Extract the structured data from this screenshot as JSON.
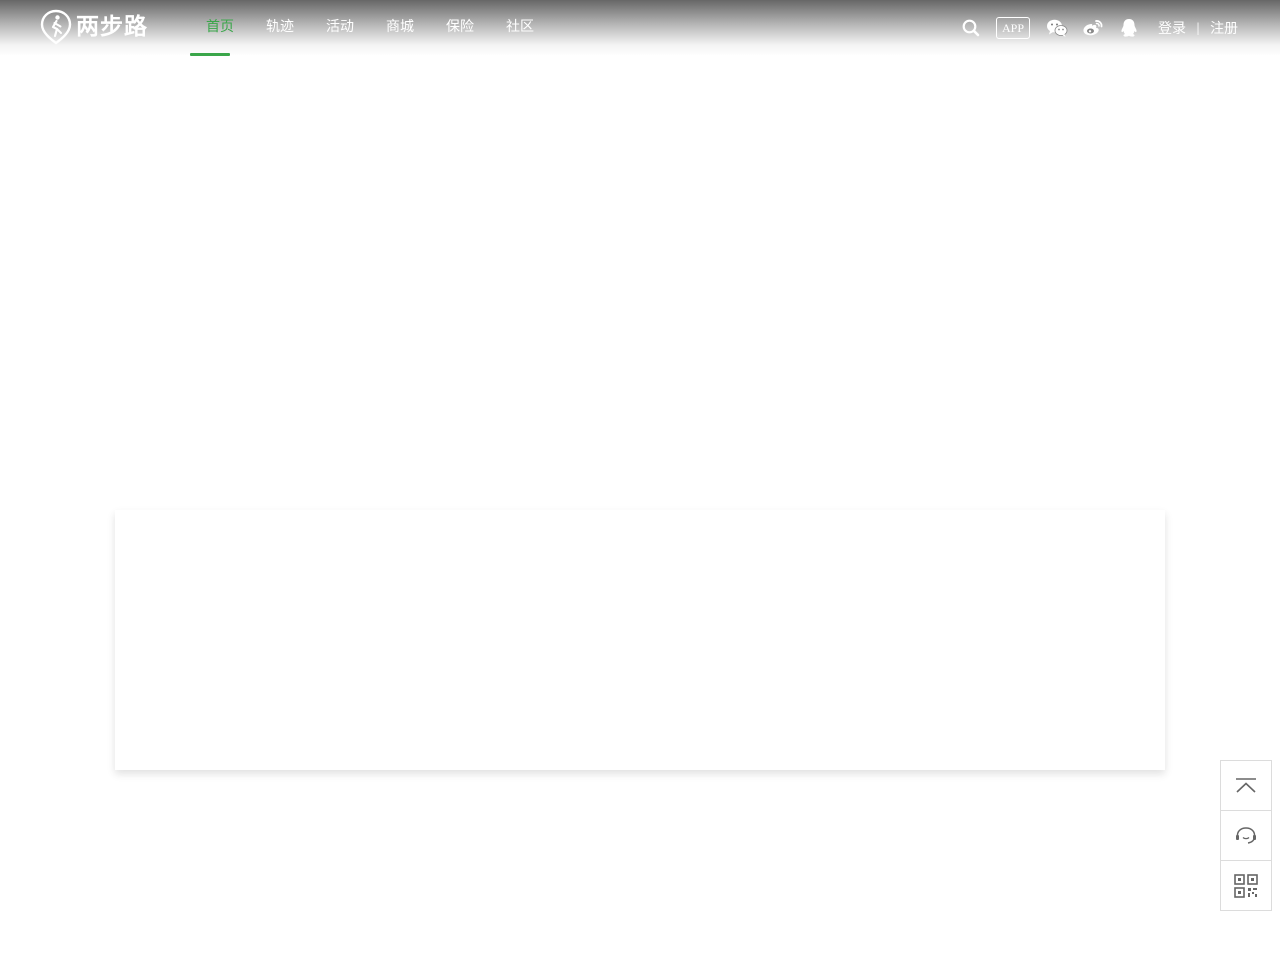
{
  "brand": {
    "logo_text": "两步路",
    "logo_icon": "walker-pin-icon"
  },
  "nav": {
    "items": [
      {
        "label": "首页",
        "active": true
      },
      {
        "label": "轨迹",
        "active": false
      },
      {
        "label": "活动",
        "active": false
      },
      {
        "label": "商城",
        "active": false
      },
      {
        "label": "保险",
        "active": false
      },
      {
        "label": "社区",
        "active": false
      }
    ],
    "active_color": "#3aa64a"
  },
  "toolbar": {
    "search_icon": "search-icon",
    "app_label": "APP",
    "wechat_icon": "wechat-icon",
    "weibo_icon": "weibo-icon",
    "qq_icon": "qq-icon"
  },
  "auth": {
    "login_label": "登录",
    "separator": "|",
    "register_label": "注册"
  },
  "float_bar": {
    "items": [
      "back-to-top-icon",
      "customer-service-icon",
      "qr-code-icon"
    ]
  }
}
